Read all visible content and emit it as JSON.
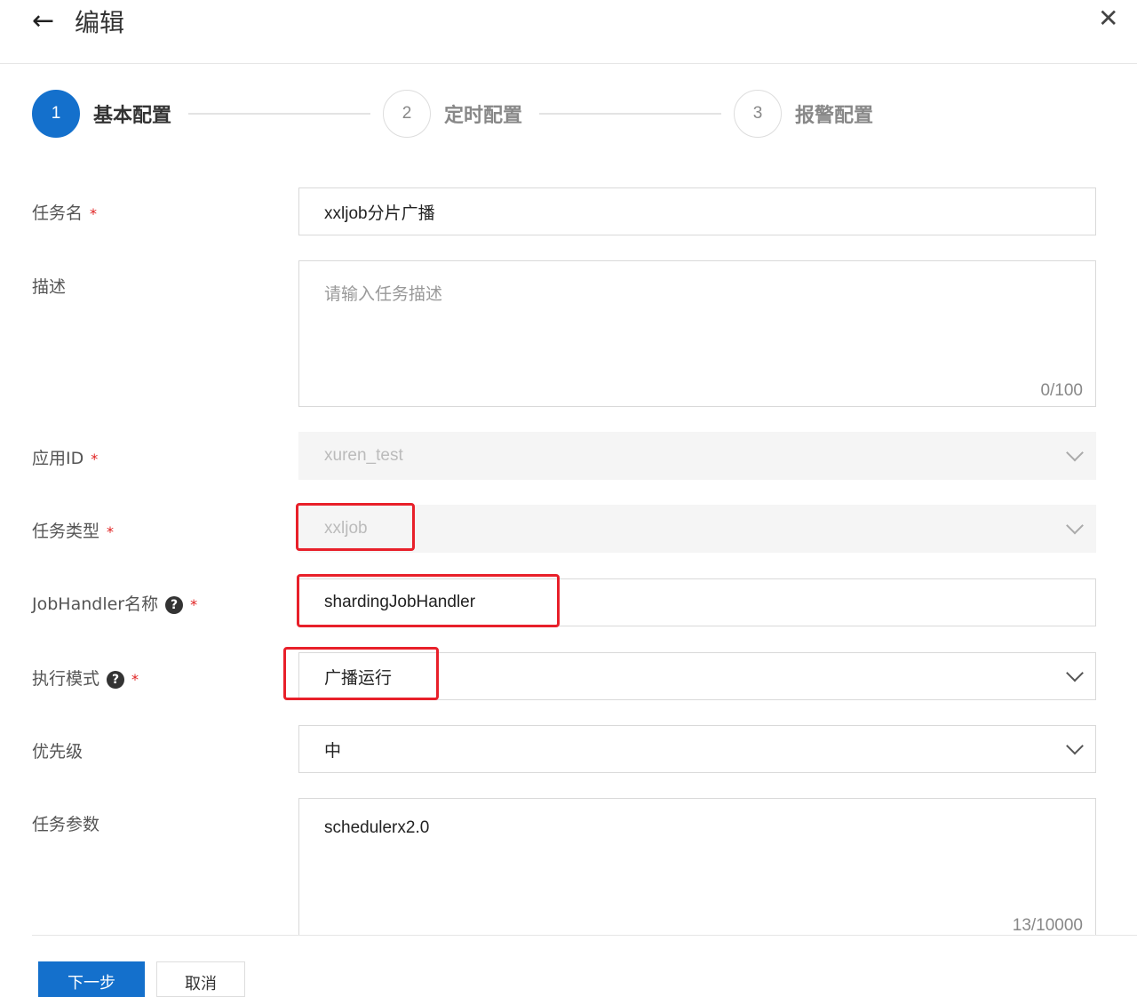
{
  "header": {
    "title": "编辑"
  },
  "steps": [
    {
      "num": "1",
      "label": "基本配置"
    },
    {
      "num": "2",
      "label": "定时配置"
    },
    {
      "num": "3",
      "label": "报警配置"
    }
  ],
  "form": {
    "task_name": {
      "label": "任务名",
      "value": "xxljob分片广播"
    },
    "description": {
      "label": "描述",
      "placeholder": "请输入任务描述",
      "count": "0/100"
    },
    "app_id": {
      "label": "应用ID",
      "value": "xuren_test"
    },
    "task_type": {
      "label": "任务类型",
      "value": "xxljob"
    },
    "job_handler": {
      "label": "JobHandler名称",
      "value": "shardingJobHandler"
    },
    "exec_mode": {
      "label": "执行模式",
      "value": "广播运行"
    },
    "priority": {
      "label": "优先级",
      "value": "中"
    },
    "params": {
      "label": "任务参数",
      "value": "schedulerx2.0",
      "count": "13/10000"
    }
  },
  "buttons": {
    "next": "下一步",
    "cancel": "取消"
  },
  "colors": {
    "primary": "#1470cc",
    "highlight": "#e8202a"
  }
}
